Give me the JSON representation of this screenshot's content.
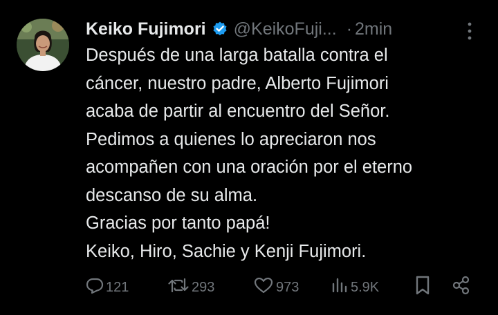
{
  "tweet": {
    "author": {
      "display_name": "Keiko Fujimori",
      "handle": "@KeikoFuji...",
      "verified_icon": "verified-badge-icon",
      "avatar": "avatar"
    },
    "time_separator": "·",
    "timestamp": "2min",
    "lines": [
      "Después de una larga batalla contra el",
      "cáncer, nuestro padre, Alberto Fujimori",
      "acaba de partir al encuentro del Señor.",
      "Pedimos a quienes lo apreciaron nos",
      "acompañen con una oración por el eterno",
      "descanso de su alma.",
      "Gracias por tanto papá!",
      "Keiko, Hiro, Sachie y Kenji Fujimori."
    ],
    "actions": {
      "replies": "121",
      "reposts": "293",
      "likes": "973",
      "views": "5.9K"
    }
  },
  "colors": {
    "background": "#000000",
    "text_primary": "#e7e9ea",
    "text_secondary": "#71767b",
    "verified_blue": "#1d9bf0"
  }
}
